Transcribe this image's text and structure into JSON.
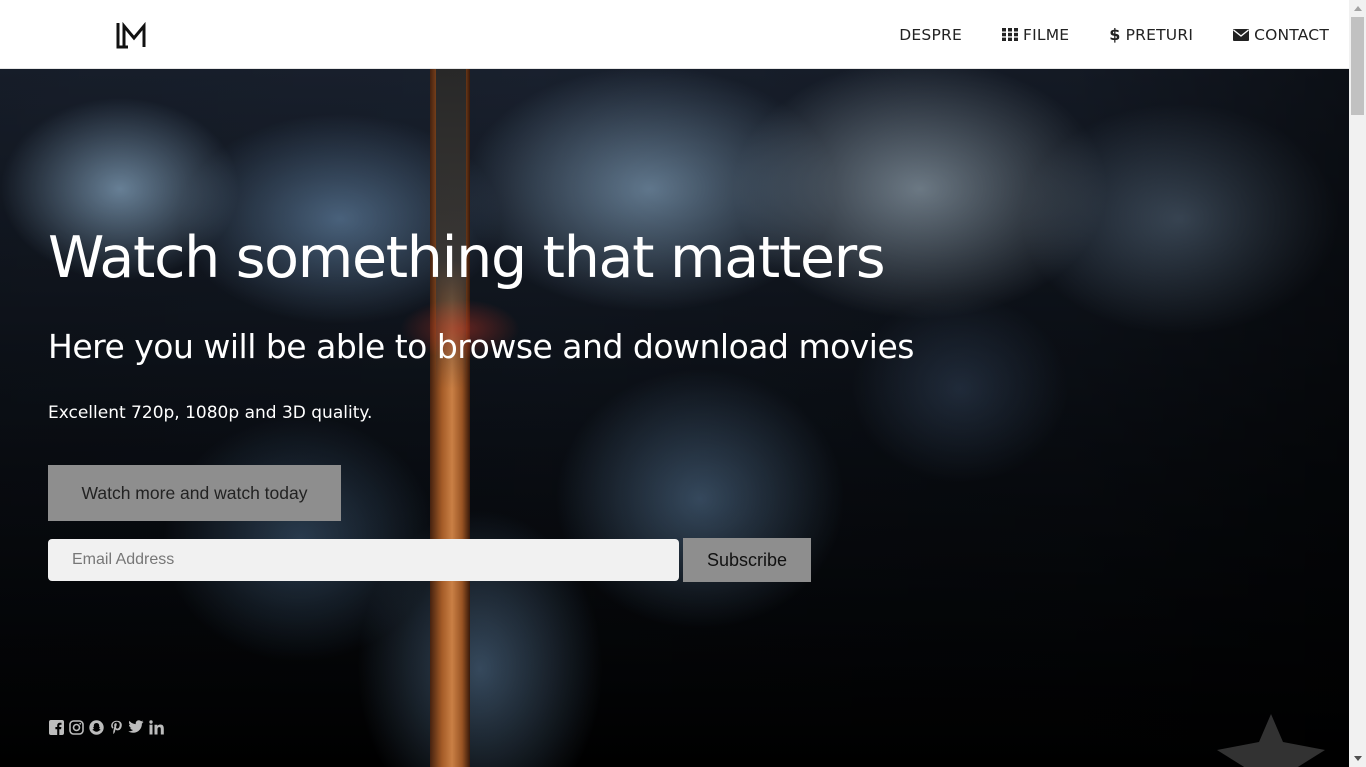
{
  "header": {
    "logo_text": "LM",
    "nav": [
      {
        "label": "DESPRE",
        "icon": ""
      },
      {
        "label": "FILME",
        "icon": "grid-icon"
      },
      {
        "label": "PRETURI",
        "icon": "dollar-icon"
      },
      {
        "label": "CONTACT",
        "icon": "envelope-icon"
      }
    ]
  },
  "hero": {
    "title": "Watch something that matters",
    "subtitle": "Here you will be able to browse and download movies",
    "tagline": "Excellent 720p, 1080p and 3D quality.",
    "cta_label": "Watch more and watch today",
    "email_placeholder": "Email Address",
    "subscribe_label": "Subscribe"
  },
  "social": [
    "facebook-icon",
    "instagram-icon",
    "snapchat-icon",
    "pinterest-icon",
    "twitter-icon",
    "linkedin-icon"
  ],
  "colors": {
    "header_bg": "#ffffff",
    "button_bg": "#8e8e8e",
    "input_bg": "#f1f1f1",
    "text_light": "#ffffff",
    "nav_text": "#222222"
  }
}
